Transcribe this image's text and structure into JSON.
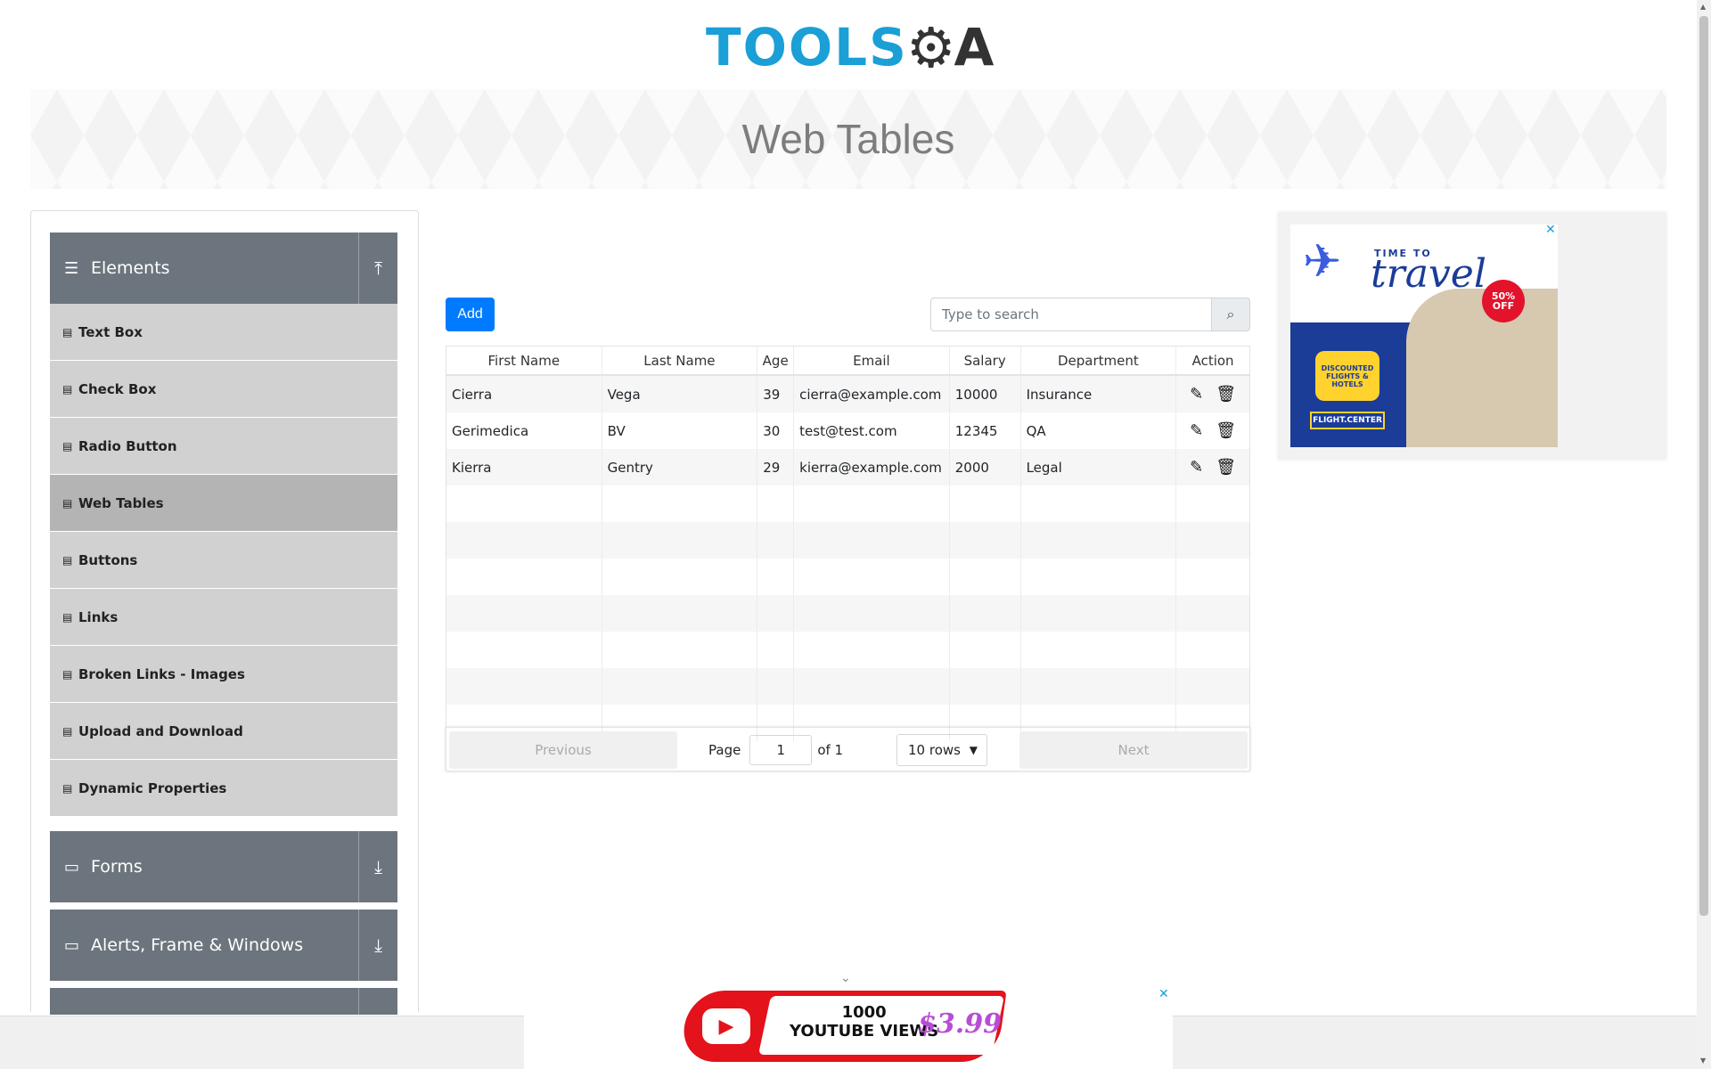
{
  "header": {
    "logo_text": "TOOLS",
    "logo_gear": "⚙",
    "logo_tail": "A"
  },
  "banner": {
    "title": "Web Tables"
  },
  "sidebar": {
    "elements_group": {
      "label": "Elements",
      "icon": "hamburger-icon",
      "toggle": "collapse-icon"
    },
    "items": [
      {
        "label": "Text Box"
      },
      {
        "label": "Check Box"
      },
      {
        "label": "Radio Button"
      },
      {
        "label": "Web Tables",
        "active": true
      },
      {
        "label": "Buttons"
      },
      {
        "label": "Links"
      },
      {
        "label": "Broken Links - Images"
      },
      {
        "label": "Upload and Download"
      },
      {
        "label": "Dynamic Properties"
      }
    ],
    "forms_group": {
      "label": "Forms"
    },
    "alerts_group": {
      "label": "Alerts, Frame & Windows"
    }
  },
  "toolbar": {
    "add_label": "Add",
    "search_placeholder": "Type to search"
  },
  "table": {
    "headers": [
      "First Name",
      "Last Name",
      "Age",
      "Email",
      "Salary",
      "Department",
      "Action"
    ],
    "rows": [
      {
        "first": "Cierra",
        "last": "Vega",
        "age": "39",
        "email": "cierra@example.com",
        "salary": "10000",
        "dept": "Insurance"
      },
      {
        "first": "Gerimedica",
        "last": "BV",
        "age": "30",
        "email": "test@test.com",
        "salary": "12345",
        "dept": "QA"
      },
      {
        "first": "Kierra",
        "last": "Gentry",
        "age": "29",
        "email": "kierra@example.com",
        "salary": "2000",
        "dept": "Legal"
      }
    ]
  },
  "pagination": {
    "previous": "Previous",
    "page_label": "Page",
    "page_value": "1",
    "of_label": "of 1",
    "rows_option": "10 rows",
    "next": "Next"
  },
  "ad_right": {
    "time_to": "TIME TO",
    "travel": "travel",
    "badge": "50% OFF",
    "bubble": "DISCOUNTED FLIGHTS & HOTELS",
    "brand": "FLIGHT.CENTER"
  },
  "ad_bottom": {
    "views": "1000\nYOUTUBE VIEWS",
    "price": "$3.99"
  },
  "colors": {
    "primary": "#007bff",
    "sidebar_group": "#6c757d",
    "sidebar_item": "#d1d1d1",
    "logo_blue": "#1a9fd6"
  }
}
